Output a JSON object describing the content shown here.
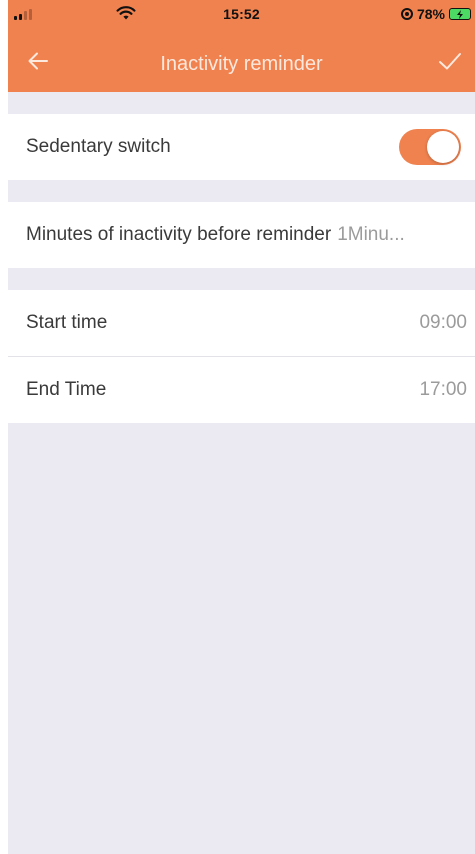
{
  "status_bar": {
    "time": "15:52",
    "battery_percent": "78%"
  },
  "header": {
    "title": "Inactivity reminder",
    "back_icon": "back-arrow-icon",
    "confirm_icon": "checkmark-icon"
  },
  "settings": {
    "sedentary_switch": {
      "label": "Sedentary switch",
      "enabled": true
    },
    "minutes": {
      "label": "Minutes of inactivity before reminder",
      "value": "1Minu..."
    },
    "start_time": {
      "label": "Start time",
      "value": "09:00"
    },
    "end_time": {
      "label": "End Time",
      "value": "17:00"
    }
  },
  "colors": {
    "accent": "#f0824f",
    "background": "#ebe9f1"
  }
}
